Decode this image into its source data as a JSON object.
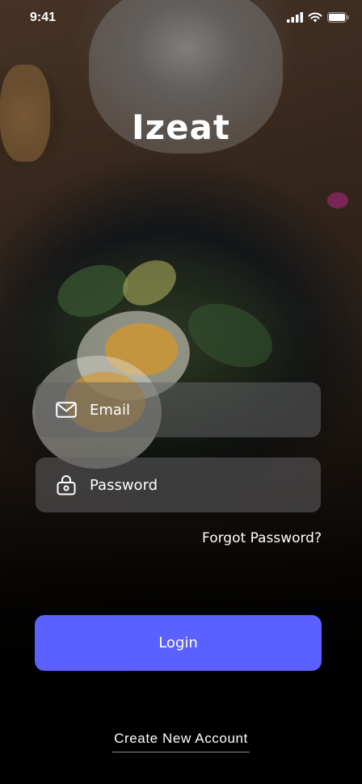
{
  "status_bar": {
    "time": "9:41"
  },
  "app": {
    "title": "Izeat"
  },
  "form": {
    "email_placeholder": "Email",
    "password_placeholder": "Password",
    "forgot_password": "Forgot Password?",
    "login_label": "Login",
    "create_account": "Create New Account"
  },
  "icons": {
    "email": "envelope-icon",
    "password": "lock-icon",
    "signal": "signal-icon",
    "wifi": "wifi-icon",
    "battery": "battery-icon"
  },
  "colors": {
    "accent": "#5a61ff",
    "field_bg": "#626264",
    "text": "#ffffff"
  }
}
